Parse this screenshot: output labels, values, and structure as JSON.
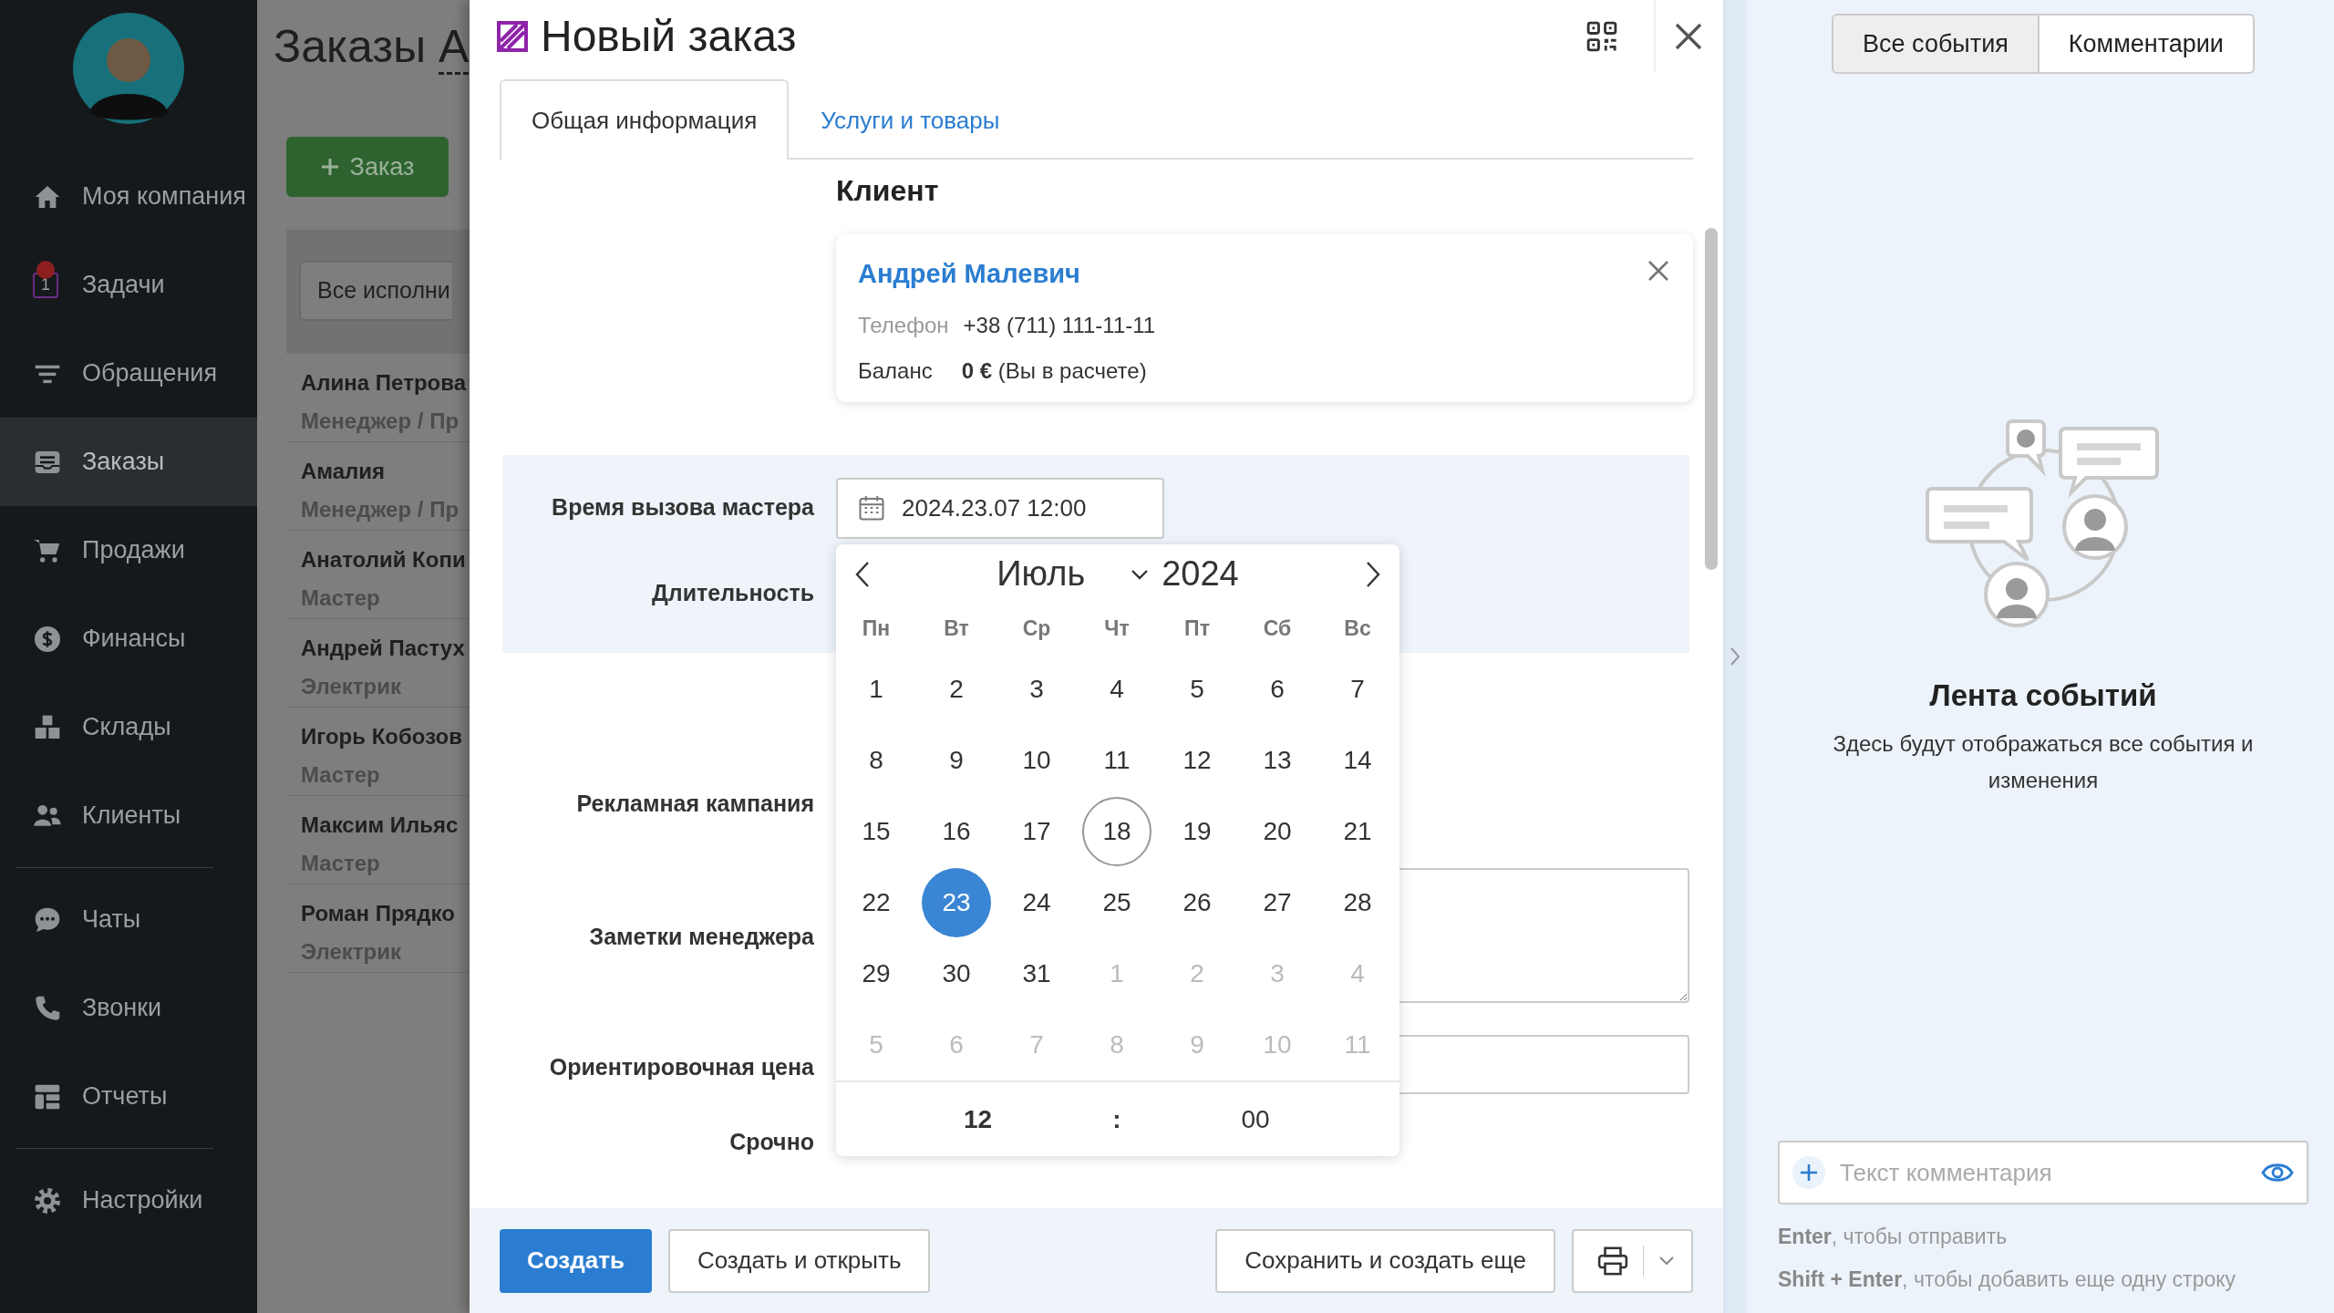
{
  "sidebar": {
    "sections": [
      [
        {
          "label": "Моя компания",
          "selected": false
        },
        {
          "label": "Задачи",
          "count": "1",
          "notification": true,
          "selected": false
        },
        {
          "label": "Обращения",
          "selected": false
        },
        {
          "label": "Заказы",
          "selected": true
        },
        {
          "label": "Продажи",
          "selected": false
        },
        {
          "label": "Финансы",
          "selected": false
        },
        {
          "label": "Склады",
          "selected": false
        },
        {
          "label": "Клиенты",
          "selected": false
        }
      ],
      [
        {
          "label": "Чаты",
          "selected": false
        },
        {
          "label": "Звонки",
          "selected": false
        },
        {
          "label": "Отчеты",
          "selected": false
        }
      ],
      [
        {
          "label": "Настройки",
          "selected": false
        }
      ]
    ]
  },
  "background_page": {
    "title": "Заказы",
    "title_dropdown": "А",
    "add_button": "Заказ",
    "filter_button": "Все исполни",
    "employees": [
      {
        "name": "Алина Петрова",
        "role": "Менеджер / Пр"
      },
      {
        "name": "Амалия",
        "role": "Менеджер / Пр"
      },
      {
        "name": "Анатолий Копи",
        "role": "Мастер"
      },
      {
        "name": "Андрей Пастух",
        "role": "Электрик"
      },
      {
        "name": "Игорь Кобозов",
        "role": "Мастер"
      },
      {
        "name": "Максим Ильяс",
        "role": "Мастер"
      },
      {
        "name": "Роман Прядко",
        "role": "Электрик"
      }
    ]
  },
  "modal": {
    "title": "Новый заказ",
    "tabs": [
      {
        "label": "Общая информация",
        "selected": true
      },
      {
        "label": "Услуги и товары",
        "selected": false
      }
    ],
    "client": {
      "heading": "Клиент",
      "name": "Андрей Малевич",
      "phone_label": "Телефон",
      "phone": "+38 (711) 111-11-11",
      "balance_label": "Баланс",
      "balance": "**0 €** (Вы в расчете)"
    },
    "fields": [
      {
        "label": "Время вызова мастера",
        "kind": "date",
        "value": "2024.23.07 12:00"
      },
      {
        "label": "Длительность",
        "kind": "covered"
      },
      {
        "label": "Рекламная кампания",
        "kind": "covered"
      },
      {
        "label": "Заметки менеджера",
        "kind": "textarea"
      },
      {
        "label": "Ориентировочная цена",
        "kind": "input"
      },
      {
        "label": "Срочно",
        "kind": "covered"
      }
    ],
    "calendar": {
      "month": "Июль",
      "year": "2024",
      "weekdays": [
        "Пн",
        "Вт",
        "Ср",
        "Чт",
        "Пт",
        "Сб",
        "Вс"
      ],
      "days": [
        {
          "day": "1",
          "outside": false,
          "today": false,
          "selected": false
        },
        {
          "day": "2",
          "outside": false,
          "today": false,
          "selected": false
        },
        {
          "day": "3",
          "outside": false,
          "today": false,
          "selected": false
        },
        {
          "day": "4",
          "outside": false,
          "today": false,
          "selected": false
        },
        {
          "day": "5",
          "outside": false,
          "today": false,
          "selected": false
        },
        {
          "day": "6",
          "outside": false,
          "today": false,
          "selected": false
        },
        {
          "day": "7",
          "outside": false,
          "today": false,
          "selected": false
        },
        {
          "day": "8",
          "outside": false,
          "today": false,
          "selected": false
        },
        {
          "day": "9",
          "outside": false,
          "today": false,
          "selected": false
        },
        {
          "day": "10",
          "outside": false,
          "today": false,
          "selected": false
        },
        {
          "day": "11",
          "outside": false,
          "today": false,
          "selected": false
        },
        {
          "day": "12",
          "outside": false,
          "today": false,
          "selected": false
        },
        {
          "day": "13",
          "outside": false,
          "today": false,
          "selected": false
        },
        {
          "day": "14",
          "outside": false,
          "today": false,
          "selected": false
        },
        {
          "day": "15",
          "outside": false,
          "today": false,
          "selected": false
        },
        {
          "day": "16",
          "outside": false,
          "today": false,
          "selected": false
        },
        {
          "day": "17",
          "outside": false,
          "today": false,
          "selected": false
        },
        {
          "day": "18",
          "outside": false,
          "today": true,
          "selected": false
        },
        {
          "day": "19",
          "outside": false,
          "today": false,
          "selected": false
        },
        {
          "day": "20",
          "outside": false,
          "today": false,
          "selected": false
        },
        {
          "day": "21",
          "outside": false,
          "today": false,
          "selected": false
        },
        {
          "day": "22",
          "outside": false,
          "today": false,
          "selected": false
        },
        {
          "day": "23",
          "outside": false,
          "today": false,
          "selected": true
        },
        {
          "day": "24",
          "outside": false,
          "today": false,
          "selected": false
        },
        {
          "day": "25",
          "outside": false,
          "today": false,
          "selected": false
        },
        {
          "day": "26",
          "outside": false,
          "today": false,
          "selected": false
        },
        {
          "day": "27",
          "outside": false,
          "today": false,
          "selected": false
        },
        {
          "day": "28",
          "outside": false,
          "today": false,
          "selected": false
        },
        {
          "day": "29",
          "outside": false,
          "today": false,
          "selected": false
        },
        {
          "day": "30",
          "outside": false,
          "today": false,
          "selected": false
        },
        {
          "day": "31",
          "outside": false,
          "today": false,
          "selected": false
        },
        {
          "day": "1",
          "outside": true,
          "today": false,
          "selected": false
        },
        {
          "day": "2",
          "outside": true,
          "today": false,
          "selected": false
        },
        {
          "day": "3",
          "outside": true,
          "today": false,
          "selected": false
        },
        {
          "day": "4",
          "outside": true,
          "today": false,
          "selected": false
        },
        {
          "day": "5",
          "outside": true,
          "today": false,
          "selected": false
        },
        {
          "day": "6",
          "outside": true,
          "today": false,
          "selected": false
        },
        {
          "day": "7",
          "outside": true,
          "today": false,
          "selected": false
        },
        {
          "day": "8",
          "outside": true,
          "today": false,
          "selected": false
        },
        {
          "day": "9",
          "outside": true,
          "today": false,
          "selected": false
        },
        {
          "day": "10",
          "outside": true,
          "today": false,
          "selected": false
        },
        {
          "day": "11",
          "outside": true,
          "today": false,
          "selected": false
        }
      ],
      "hour": "12",
      "separator": ":",
      "minute": "00"
    },
    "footer_buttons": [
      {
        "label": "Создать",
        "kind": "primary"
      },
      {
        "label": "Создать и открыть",
        "kind": "secondary"
      },
      {
        "label": "Сохранить и создать еще",
        "kind": "secondary"
      }
    ]
  },
  "events_panel": {
    "filters": [
      {
        "label": "Все события",
        "selected": true
      },
      {
        "label": "Комментарии",
        "selected": false
      }
    ],
    "empty_title": "Лента событий",
    "empty_text": "Здесь будут отображаться все события и изменения",
    "comment": {
      "placeholder": "Текст комментария"
    },
    "hints": [
      "**Enter**, чтобы отправить",
      "**Shift + Enter**, чтобы добавить еще одну строку"
    ]
  }
}
